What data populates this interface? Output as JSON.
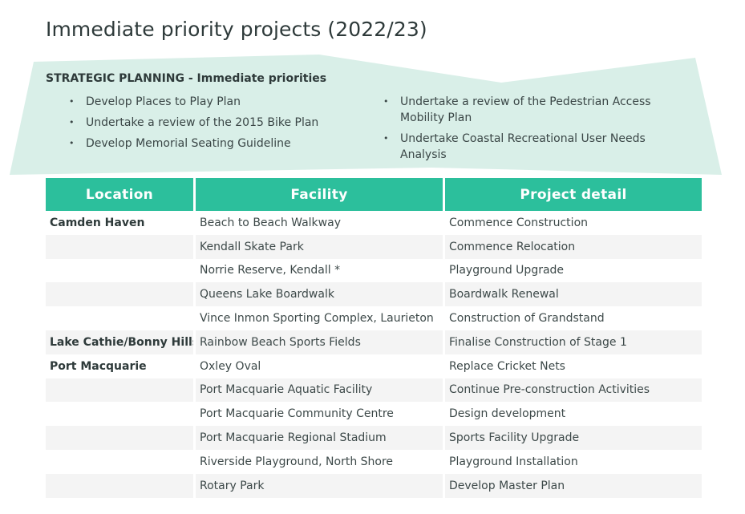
{
  "page": {
    "title": "Immediate priority projects (2022/23)"
  },
  "banner": {
    "heading": "STRATEGIC PLANNING - Immediate priorities",
    "fill_color": "#d9efe8",
    "left_items": [
      "Develop Places to Play Plan",
      "Undertake a review of the 2015 Bike Plan",
      "Develop Memorial Seating Guideline"
    ],
    "right_items": [
      "Undertake a review of the Pedestrian Access Mobility Plan",
      "Undertake Coastal Recreational User Needs Analysis"
    ]
  },
  "table": {
    "header_color": "#2cbf9c",
    "headers": [
      "Location",
      "Facility",
      "Project detail"
    ],
    "rows": [
      {
        "location": "Camden Haven",
        "facility": "Beach to Beach Walkway",
        "detail": "Commence Construction"
      },
      {
        "location": "",
        "facility": "Kendall Skate Park",
        "detail": "Commence Relocation"
      },
      {
        "location": "",
        "facility": "Norrie Reserve, Kendall *",
        "detail": "Playground Upgrade"
      },
      {
        "location": "",
        "facility": "Queens Lake Boardwalk",
        "detail": "Boardwalk Renewal"
      },
      {
        "location": "",
        "facility": "Vince Inmon Sporting Complex, Laurieton",
        "detail": "Construction of Grandstand"
      },
      {
        "location": "Lake Cathie/Bonny Hills",
        "facility": "Rainbow Beach Sports Fields",
        "detail": "Finalise Construction of Stage 1"
      },
      {
        "location": "Port Macquarie",
        "facility": "Oxley Oval",
        "detail": "Replace Cricket Nets"
      },
      {
        "location": "",
        "facility": "Port Macquarie Aquatic Facility",
        "detail": "Continue Pre-construction Activities"
      },
      {
        "location": "",
        "facility": "Port Macquarie Community Centre",
        "detail": "Design development"
      },
      {
        "location": "",
        "facility": "Port Macquarie Regional Stadium",
        "detail": "Sports Facility Upgrade"
      },
      {
        "location": "",
        "facility": "Riverside Playground, North Shore",
        "detail": "Playground Installation"
      },
      {
        "location": "",
        "facility": "Rotary Park",
        "detail": "Develop Master Plan"
      }
    ]
  }
}
